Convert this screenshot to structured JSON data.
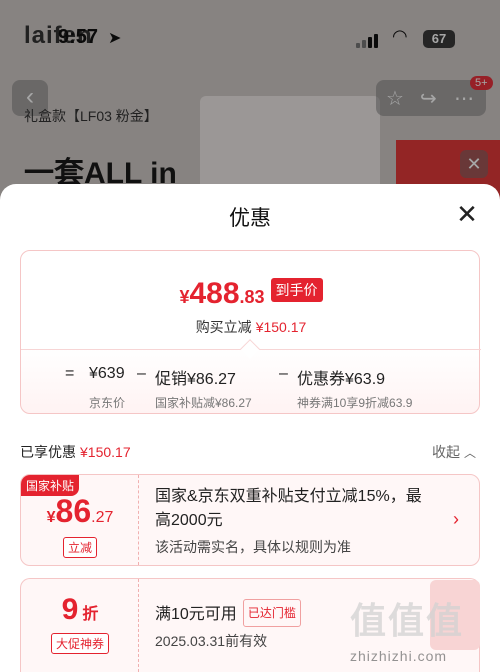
{
  "status_bar": {
    "time": "9:57",
    "battery": "67"
  },
  "background": {
    "brand": "laifen",
    "subtitle": "礼盒款【LF03 粉金】",
    "headline": "一套ALL in",
    "cart_badge": "5+"
  },
  "sheet": {
    "title": "优惠"
  },
  "price_card": {
    "currency": "¥",
    "price_int": "488",
    "price_dec": ".83",
    "price_tag": "到手价",
    "reduce_label": "购买立减",
    "reduce_amount": "¥150.17",
    "formula": {
      "equals": "=",
      "base_price": "¥639",
      "minus1": "–",
      "promo_label": "促销¥86.27",
      "minus2": "–",
      "coupon_label": "优惠券¥63.9",
      "base_note": "京东价",
      "promo_note": "国家补贴减¥86.27",
      "coupon_note": "神券满10享9折减63.9"
    }
  },
  "enjoyed": {
    "label": "已享优惠",
    "amount": "¥150.17",
    "collapse_label": "收起"
  },
  "coupons": [
    {
      "tag": "国家补贴",
      "currency": "¥",
      "value_int": "86",
      "value_dec": ".27",
      "pill": "立减",
      "desc_line1": "国家&京东双重补贴支付立减15%，最",
      "desc_line2": "高2000元",
      "note": "该活动需实名，具体以规则为准"
    },
    {
      "value_int": "9",
      "unit": "折",
      "pill": "大促神券",
      "desc": "满10元可用",
      "status": "已达门槛",
      "note": "2025.03.31前有效"
    }
  ],
  "watermark": {
    "text": "值值值",
    "url": "zhizhizhi.com"
  },
  "colors": {
    "accent": "#e4232f",
    "card_border": "#f5c6c6"
  }
}
